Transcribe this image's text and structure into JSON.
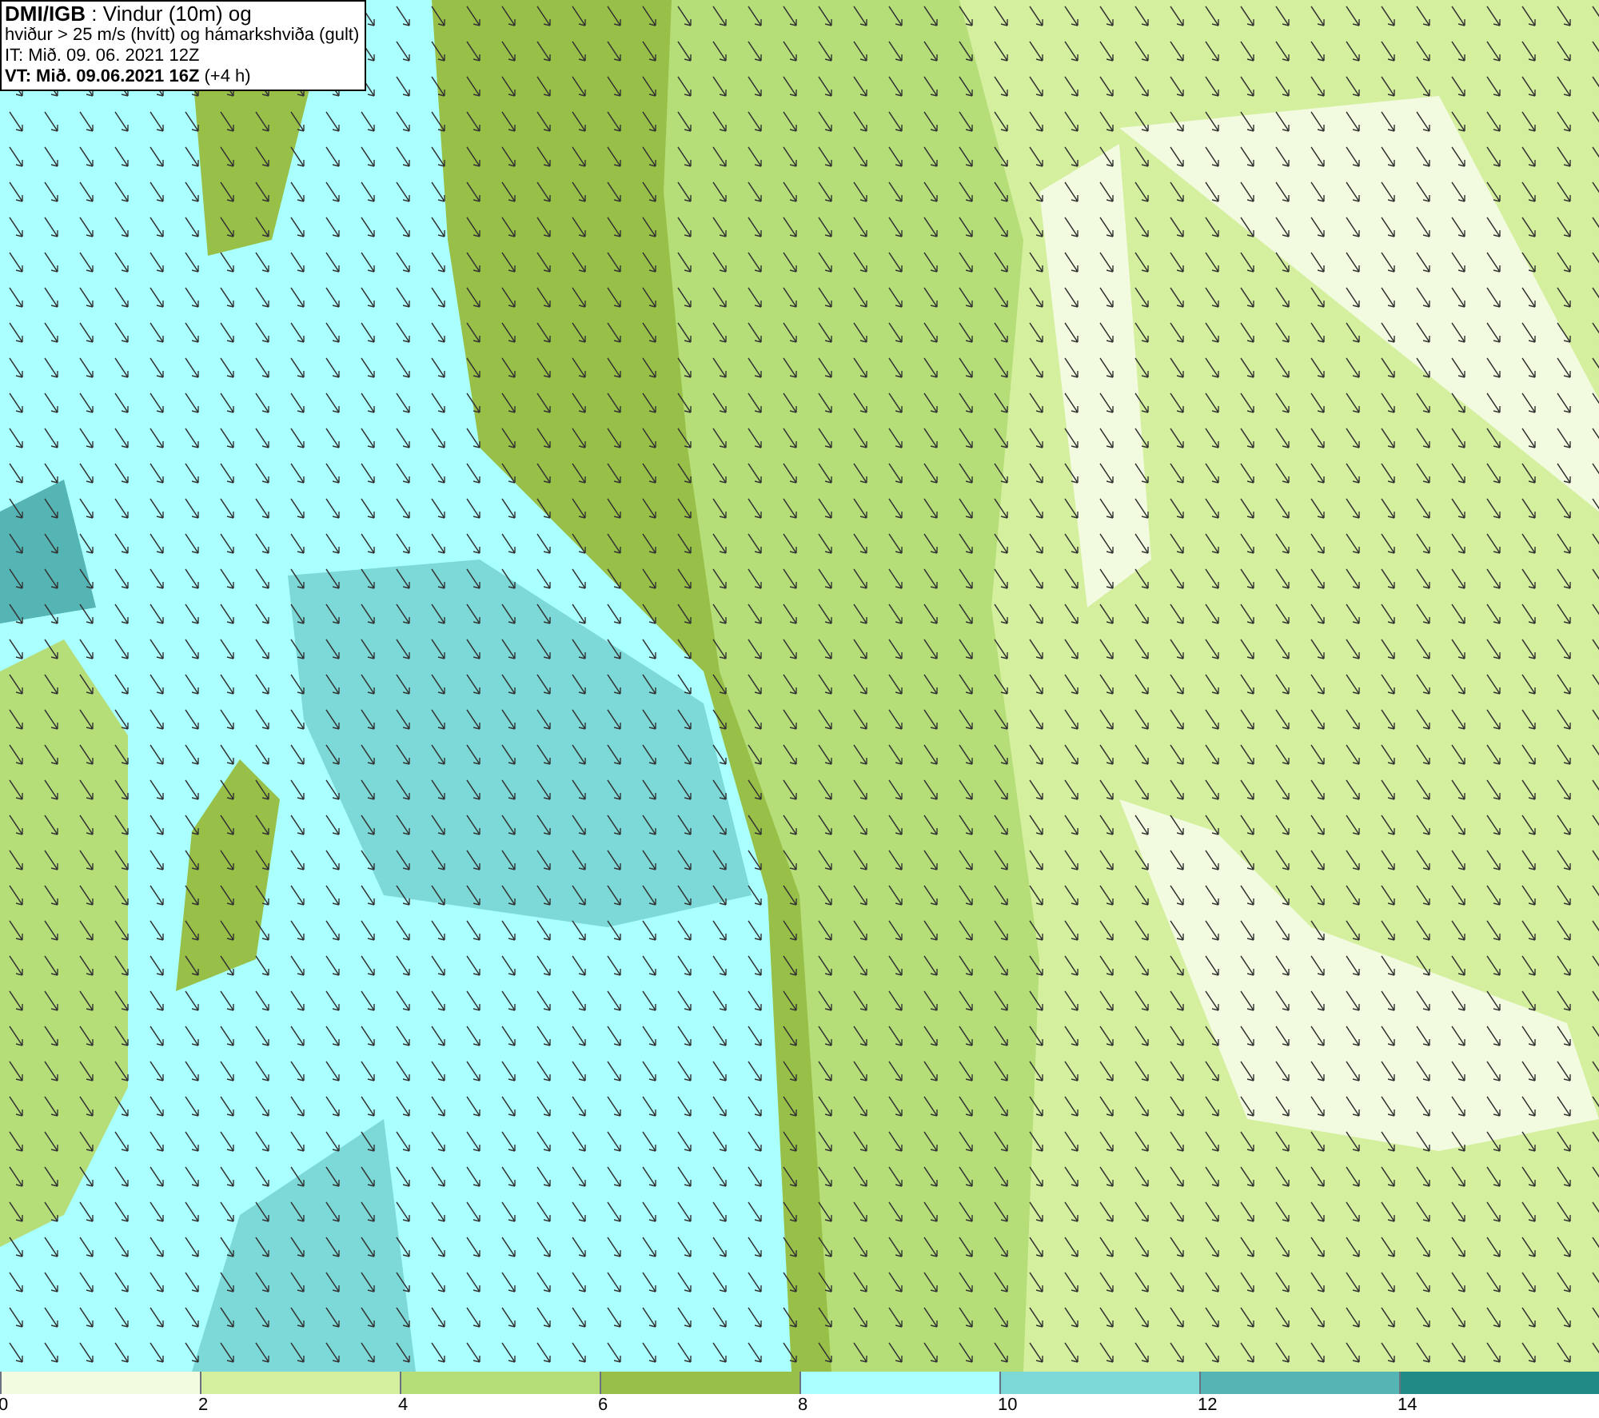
{
  "title_box": {
    "lines": [
      "**DMI/IGB** : Vindur (10m) og",
      "hviður > 25 m/s (hvítt) og hámarkshviða (gult)",
      "IT: Mið. 09. 06. 2021 12Z",
      "**VT: Mið. 09.06.2021 16Z** (+4 h)"
    ]
  },
  "legend": [
    {
      "label": "0",
      "color": "#f2fbe0"
    },
    {
      "label": "2",
      "color": "#d4ef9e"
    },
    {
      "label": "4",
      "color": "#b5dd78"
    },
    {
      "label": "6",
      "color": "#98c048"
    },
    {
      "label": "8",
      "color": "#aaffff"
    },
    {
      "label": "10",
      "color": "#7dd8d8"
    },
    {
      "label": "12",
      "color": "#55b5b5"
    },
    {
      "label": "14",
      "color": "#208a86"
    }
  ]
}
